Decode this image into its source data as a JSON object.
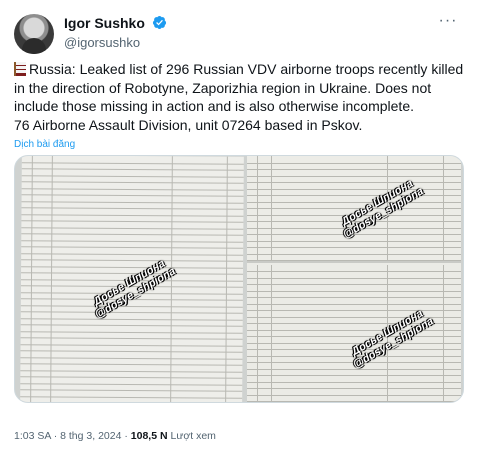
{
  "author": {
    "display_name": "Igor Sushko",
    "handle": "@igorsushko",
    "verified_color": "#1d9bf0"
  },
  "more_icon_text": "···",
  "tweet": {
    "line1": "Russia: Leaked list of 296 Russian VDV airborne troops recently killed",
    "line2": "in the direction of Robotyne, Zaporizhia region in Ukraine. Does not",
    "line3": "include those missing in action and is also otherwise incomplete.",
    "line4": "76 Airborne Assault Division, unit 07264 based in Pskov."
  },
  "translate_label": "Dịch bài đăng",
  "media": {
    "watermark_line1": "Досье Шпиона",
    "watermark_line2": "@dosye_shpiona"
  },
  "meta": {
    "time": "1:03 SA",
    "date": "8 thg 3, 2024",
    "views": "108,5 N",
    "views_label": "Lượt xem"
  }
}
